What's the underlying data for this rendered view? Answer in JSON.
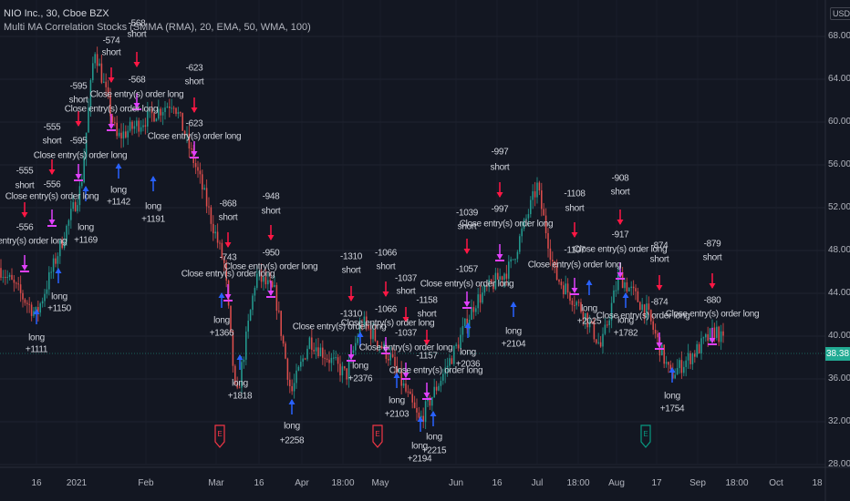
{
  "header": {
    "symbol": "NIO Inc., 30, Cboe BZX",
    "indicator": "Multi MA Correlation Stocks (SMMA (RMA), 20, EMA, 50, WMA, 100)"
  },
  "price_axis": {
    "currency": "USD",
    "labels": [
      "68.00",
      "64.00",
      "60.00",
      "56.00",
      "52.00",
      "48.00",
      "44.00",
      "40.00",
      "36.00",
      "32.00",
      "28.00"
    ],
    "last_price": "38.38"
  },
  "time_axis": {
    "labels": [
      "16",
      "2021",
      "Feb",
      "Mar",
      "16",
      "Apr",
      "18:00",
      "May",
      "Jun",
      "16",
      "Jul",
      "18:00",
      "Aug",
      "17",
      "Sep",
      "18:00",
      "Oct",
      "18"
    ]
  },
  "colors": {
    "background": "#131722",
    "up": "#26a69a",
    "down": "#ef5350",
    "short_arrow": "#ff1744",
    "long_arrow": "#2962ff",
    "close_marker": "#e040fb",
    "last_price": "#22ab94",
    "earnings_red": "#f23645",
    "earnings_green": "#089981"
  },
  "events": [
    {
      "label": "E",
      "type": "earnings",
      "color": "red"
    },
    {
      "label": "E",
      "type": "earnings",
      "color": "red"
    },
    {
      "label": "E",
      "type": "earnings",
      "color": "green"
    }
  ],
  "annotations": [
    "-568",
    "short",
    "-574",
    "short",
    "-568",
    "Close entry(s) order long",
    "-595",
    "short",
    "Close entry(s) order long",
    "-595",
    "Close entry(s) order long",
    "-555",
    "short",
    "-555",
    "short",
    "-556",
    "Close entry(s) order long",
    "-556",
    "Close entry(s) order long",
    "-623",
    "short",
    "-623",
    "Close entry(s) order long",
    "long",
    "+1142",
    "long",
    "+1191",
    "long",
    "+1169",
    "long",
    "+1150",
    "long",
    "+1111",
    "-868",
    "short",
    "-743",
    "Close entry(s) order long",
    "-948",
    "short",
    "-950",
    "Close entry(s) order long",
    "long",
    "+1366",
    "long",
    "+1818",
    "long",
    "+2258",
    "-1310",
    "short",
    "-1310",
    "Close entry(s) order long",
    "-1066",
    "short",
    "-1066",
    "Close entry(s) order long",
    "-1037",
    "short",
    "-1037",
    "Close entry(s) order long",
    "-1158",
    "short",
    "-1157",
    "Close entry(s) order long",
    "long",
    "+2376",
    "long",
    "+2103",
    "long",
    "+2194",
    "long",
    "+2215",
    "-1039",
    "short",
    "-1057",
    "Close entry(s) order long",
    "-997",
    "short",
    "-997",
    "Close entry(s) order long",
    "long",
    "+2036",
    "long",
    "+2104",
    "-1108",
    "short",
    "-1107",
    "Close entry(s) order long",
    "-908",
    "short",
    "-917",
    "Close entry(s) order long",
    "-874",
    "short",
    "-874",
    "Close entry(s) order long",
    "-879",
    "short",
    "-880",
    "Close entry(s) order long",
    "long",
    "+2025",
    "long",
    "+1782",
    "long",
    "+1754"
  ],
  "chart_data": {
    "type": "candlestick",
    "symbol": "NIO",
    "interval": "30",
    "ylim": [
      28,
      68
    ],
    "grid": true,
    "last_price": 38.38,
    "approx_price_path": [
      [
        "2020-12-01",
        46.5
      ],
      [
        "2020-12-16",
        42.0
      ],
      [
        "2021-01-03",
        54.0
      ],
      [
        "2021-01-09",
        67.0
      ],
      [
        "2021-01-19",
        58.5
      ],
      [
        "2021-02-12",
        62.0
      ],
      [
        "2021-02-22",
        55.0
      ],
      [
        "2021-03-04",
        46.5
      ],
      [
        "2021-03-08",
        33.8
      ],
      [
        "2021-03-15",
        45.7
      ],
      [
        "2021-03-22",
        44.0
      ],
      [
        "2021-03-28",
        34.6
      ],
      [
        "2021-04-04",
        39.7
      ],
      [
        "2021-04-18",
        36.3
      ],
      [
        "2021-04-24",
        41.4
      ],
      [
        "2021-05-05",
        38.0
      ],
      [
        "2021-05-17",
        32.0
      ],
      [
        "2021-06-01",
        38.9
      ],
      [
        "2021-06-08",
        43.2
      ],
      [
        "2021-06-21",
        46.5
      ],
      [
        "2021-07-01",
        54.0
      ],
      [
        "2021-07-08",
        45.7
      ],
      [
        "2021-07-19",
        42.3
      ],
      [
        "2021-07-26",
        38.9
      ],
      [
        "2021-08-02",
        45.7
      ],
      [
        "2021-08-13",
        42.3
      ],
      [
        "2021-08-22",
        36.3
      ],
      [
        "2021-08-31",
        38.5
      ],
      [
        "2021-09-08",
        40.6
      ],
      [
        "2021-09-13",
        38.4
      ]
    ]
  }
}
